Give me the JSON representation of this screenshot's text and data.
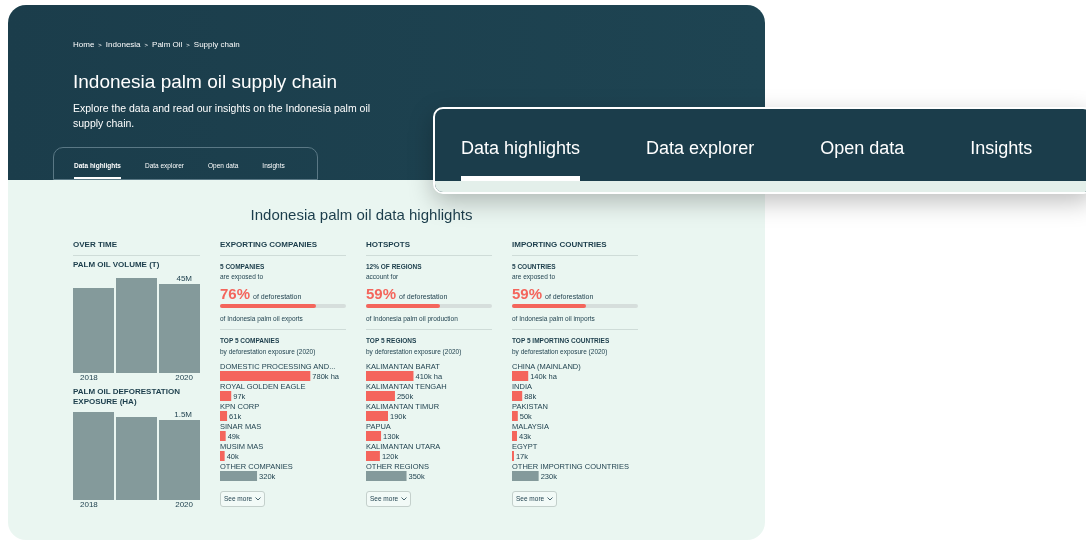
{
  "breadcrumb": [
    "Home",
    "Indonesia",
    "Palm Oil",
    "Supply chain"
  ],
  "breadcrumb_separator": ">",
  "title": "Indonesia palm oil supply chain",
  "description": "Explore the data and read our insights on the Indonesia palm oil supply chain.",
  "tabs": [
    {
      "label": "Data highlights",
      "selected": true
    },
    {
      "label": "Data explorer",
      "selected": false
    },
    {
      "label": "Open data",
      "selected": false
    },
    {
      "label": "Insights",
      "selected": false
    }
  ],
  "zoomed_tabs": [
    {
      "label": "Data highlights",
      "selected": true
    },
    {
      "label": "Data explorer",
      "selected": false
    },
    {
      "label": "Open data",
      "selected": false
    },
    {
      "label": "Insights",
      "selected": false
    }
  ],
  "section_title": "Indonesia palm oil data highlights",
  "over_time": {
    "heading": "OVER TIME",
    "charts": [
      {
        "title": "PALM OIL VOLUME (T)",
        "value_label": "45M",
        "first_label": "2018",
        "last_label": "2020"
      },
      {
        "title": "PALM OIL DEFORESTATION EXPOSURE (HA)",
        "value_label": "1.5M",
        "first_label": "2018",
        "last_label": "2020"
      }
    ]
  },
  "columns": [
    {
      "heading": "EXPORTING COMPANIES",
      "stat_title": "5 COMPANIES",
      "stat_sub": "are exposed to",
      "percent": "76%",
      "percent_text": "of deforestation",
      "level": 0.76,
      "stat_foot": "of Indonesia palm oil exports",
      "top_title": "TOP 5 COMPANIES",
      "top_sub": "by deforestation exposure (2020)",
      "chart_data": {
        "type": "bar",
        "orientation": "horizontal",
        "categories": [
          "DOMESTIC PROCESSING AND...",
          "ROYAL GOLDEN EAGLE",
          "KPN CORP",
          "SINAR MAS",
          "MUSIM MAS",
          "OTHER COMPANIES"
        ],
        "values": [
          780,
          97,
          61,
          49,
          40,
          320
        ],
        "colors": [
          "#f4655c",
          "#f4655c",
          "#f4655c",
          "#f4655c",
          "#f4655c",
          "#849a9b"
        ],
        "value_labels": [
          "780k ha",
          "97k",
          "61k",
          "49k",
          "40k",
          "320k"
        ]
      },
      "more": "See more"
    },
    {
      "heading": "HOTSPOTS",
      "stat_title": "12% OF REGIONS",
      "stat_sub": "account for",
      "percent": "59%",
      "percent_text": "of deforestation",
      "level": 0.59,
      "stat_foot": "of Indonesia palm oil production",
      "top_title": "TOP 5 REGIONS",
      "top_sub": "by deforestation exposure (2020)",
      "chart_data": {
        "type": "bar",
        "orientation": "horizontal",
        "categories": [
          "KALIMANTAN BARAT",
          "KALIMANTAN TENGAH",
          "KALIMANTAN TIMUR",
          "PAPUA",
          "KALIMANTAN UTARA",
          "OTHER REGIONS"
        ],
        "values": [
          410,
          250,
          190,
          130,
          120,
          350
        ],
        "colors": [
          "#f4655c",
          "#f4655c",
          "#f4655c",
          "#f4655c",
          "#f4655c",
          "#849a9b"
        ],
        "value_labels": [
          "410k ha",
          "250k",
          "190k",
          "130k",
          "120k",
          "350k"
        ]
      },
      "more": "See more"
    },
    {
      "heading": "IMPORTING COUNTRIES",
      "stat_title": "5 COUNTRIES",
      "stat_sub": "are exposed to",
      "percent": "59%",
      "percent_text": "of deforestation",
      "level": 0.59,
      "stat_foot": "of Indonesia palm oil imports",
      "top_title": "TOP 5 IMPORTING COUNTRIES",
      "top_sub": "by deforestation exposure (2020)",
      "chart_data": {
        "type": "bar",
        "orientation": "horizontal",
        "categories": [
          "CHINA (MAINLAND)",
          "INDIA",
          "PAKISTAN",
          "MALAYSIA",
          "EGYPT",
          "OTHER IMPORTING COUNTRIES"
        ],
        "values": [
          140,
          88,
          50,
          43,
          17,
          230
        ],
        "colors": [
          "#f4655c",
          "#f4655c",
          "#f4655c",
          "#f4655c",
          "#f4655c",
          "#849a9b"
        ],
        "value_labels": [
          "140k ha",
          "88k",
          "50k",
          "43k",
          "17k",
          "230k"
        ]
      },
      "more": "See more"
    }
  ]
}
